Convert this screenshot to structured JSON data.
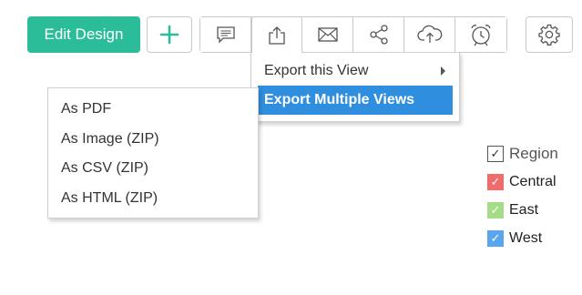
{
  "toolbar": {
    "edit_design_label": "Edit Design",
    "add_icon": "plus-icon",
    "icons": [
      "comment-icon",
      "export-icon",
      "email-icon",
      "share-icon",
      "cloud-upload-icon",
      "alarm-clock-icon"
    ],
    "settings_icon": "gear-icon",
    "accent_color": "#2bbd9a"
  },
  "export_menu": {
    "items": [
      {
        "label": "Export this View",
        "has_submenu": true
      },
      {
        "label": "Export Multiple Views",
        "highlighted": true
      }
    ],
    "highlight_color": "#2f8fde"
  },
  "export_submenu": {
    "items": [
      "As PDF",
      "As Image (ZIP)",
      "As CSV (ZIP)",
      "As HTML (ZIP)"
    ]
  },
  "legend": {
    "title": "Region",
    "items": [
      {
        "label": "Central",
        "color": "#f26b6b"
      },
      {
        "label": "East",
        "color": "#a4dd86"
      },
      {
        "label": "West",
        "color": "#5aa6ee"
      }
    ],
    "check_glyph": "✓"
  }
}
